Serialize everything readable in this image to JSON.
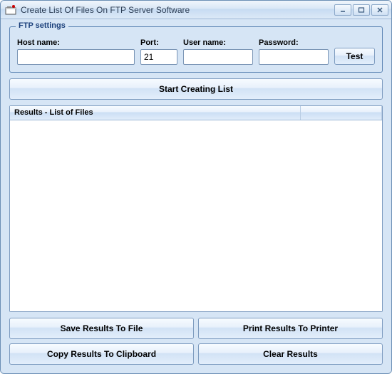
{
  "window": {
    "title": "Create List Of Files On FTP Server Software"
  },
  "ftp": {
    "legend": "FTP settings",
    "host_label": "Host name:",
    "host_value": "",
    "port_label": "Port:",
    "port_value": "21",
    "user_label": "User name:",
    "user_value": "",
    "pass_label": "Password:",
    "pass_value": "",
    "test_label": "Test"
  },
  "actions": {
    "start_label": "Start Creating List"
  },
  "results": {
    "header": "Results - List of Files"
  },
  "buttons": {
    "save": "Save Results To File",
    "print": "Print Results To Printer",
    "copy": "Copy Results To Clipboard",
    "clear": "Clear Results"
  }
}
